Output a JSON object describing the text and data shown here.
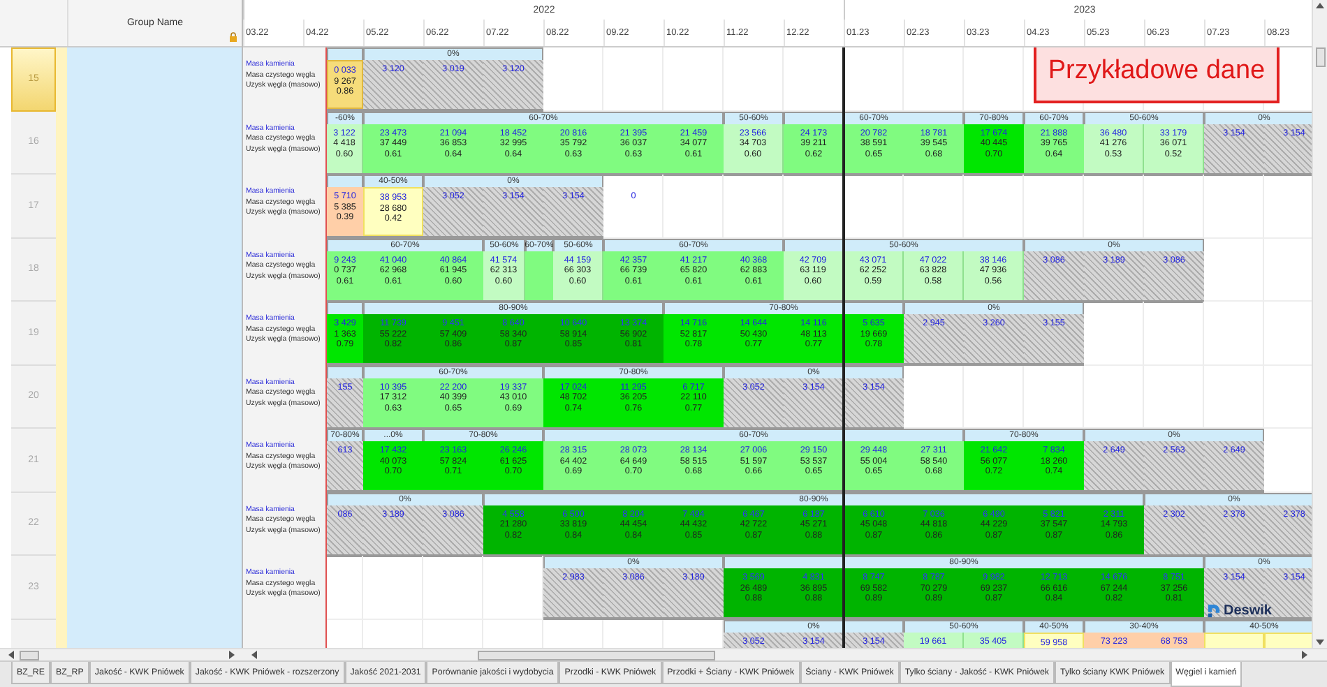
{
  "left_pane": {
    "header": "Group Name"
  },
  "timeline": {
    "years": [
      {
        "label": "2022",
        "months": [
          "03.22",
          "04.22",
          "05.22",
          "06.22",
          "07.22",
          "08.22",
          "09.22",
          "10.22",
          "11.22",
          "12.22"
        ]
      },
      {
        "label": "2023",
        "months": [
          "01.23",
          "02.23",
          "03.23",
          "04.23",
          "05.23",
          "06.23",
          "07.23",
          "08.23"
        ]
      }
    ]
  },
  "watermark_note": "Przykładowe dane",
  "rows": [
    {
      "number": "15",
      "selected": true,
      "labels": [
        "Masa kamienia",
        "Masa czystego węgla",
        "Uzysk węgla (masowo)"
      ],
      "groups": [
        {
          "cells": [
            {
              "kind": "gold",
              "values": [
                "0 033",
                "9 267",
                "0.86"
              ]
            }
          ]
        },
        {
          "label": "0%",
          "cells": [
            {
              "kind": "hatched",
              "values": [
                "3 120"
              ]
            },
            {
              "kind": "hatched",
              "values": [
                "3 019"
              ]
            },
            {
              "kind": "hatched",
              "values": [
                "3 120"
              ]
            }
          ]
        }
      ]
    },
    {
      "number": "16",
      "selected": false,
      "labels": [
        "Masa kamienia",
        "Masa czystego węgla",
        "Uzysk węgla (masowo)"
      ],
      "groups": [
        {
          "label": "-60%",
          "cells": [
            {
              "kind": "pale",
              "values": [
                "3 122",
                "4 418",
                "0.60"
              ]
            }
          ]
        },
        {
          "label": "60-70%",
          "cells": [
            {
              "kind": "green",
              "values": [
                "23 473",
                "37 449",
                "0.61"
              ]
            },
            {
              "kind": "green",
              "values": [
                "21 094",
                "36 853",
                "0.64"
              ]
            },
            {
              "kind": "green",
              "values": [
                "18 452",
                "32 995",
                "0.64"
              ]
            },
            {
              "kind": "green",
              "values": [
                "20 816",
                "35 792",
                "0.63"
              ]
            },
            {
              "kind": "green",
              "values": [
                "21 395",
                "36 037",
                "0.63"
              ]
            },
            {
              "kind": "green",
              "values": [
                "21 459",
                "34 077",
                "0.61"
              ]
            }
          ]
        },
        {
          "label": "50-60%",
          "cells": [
            {
              "kind": "pale",
              "values": [
                "23 566",
                "34 703",
                "0.60"
              ]
            }
          ]
        },
        {
          "label": "60-70%",
          "cells": [
            {
              "kind": "green",
              "values": [
                "24 173",
                "39 211",
                "0.62"
              ]
            },
            {
              "kind": "green",
              "values": [
                "20 782",
                "38 591",
                "0.65"
              ]
            },
            {
              "kind": "green",
              "values": [
                "18 781",
                "39 545",
                "0.68"
              ]
            }
          ]
        },
        {
          "label": "70-80%",
          "cells": [
            {
              "kind": "bright",
              "values": [
                "17 674",
                "40 445",
                "0.70"
              ]
            }
          ]
        },
        {
          "label": "60-70%",
          "cells": [
            {
              "kind": "green",
              "values": [
                "21 888",
                "39 765",
                "0.64"
              ]
            }
          ]
        },
        {
          "label": "50-60%",
          "cells": [
            {
              "kind": "pale",
              "values": [
                "36 480",
                "41 276",
                "0.53"
              ]
            },
            {
              "kind": "pale",
              "values": [
                "33 179",
                "36 071",
                "0.52"
              ]
            }
          ]
        },
        {
          "label": "0%",
          "cells": [
            {
              "kind": "hatched",
              "values": [
                "3 154"
              ]
            },
            {
              "kind": "hatched",
              "values": [
                "3 154"
              ]
            }
          ]
        }
      ]
    },
    {
      "number": "17",
      "selected": false,
      "labels": [
        "Masa kamienia",
        "Masa czystego węgla",
        "Uzysk węgla (masowo)"
      ],
      "groups": [
        {
          "cells": [
            {
              "kind": "orange",
              "values": [
                "5 710",
                "5 385",
                "0.39"
              ]
            }
          ]
        },
        {
          "label": "40-50%",
          "cells": [
            {
              "kind": "yellow",
              "values": [
                "38 953",
                "28 680",
                "0.42"
              ]
            }
          ]
        },
        {
          "label": "0%",
          "cells": [
            {
              "kind": "hatched",
              "values": [
                "3 052"
              ]
            },
            {
              "kind": "hatched",
              "values": [
                "3 154"
              ]
            },
            {
              "kind": "hatched",
              "values": [
                "3 154"
              ]
            }
          ]
        },
        {
          "cells": [
            {
              "kind": "blank",
              "values": [
                "0"
              ]
            }
          ]
        }
      ]
    },
    {
      "number": "18",
      "selected": false,
      "labels": [
        "Masa kamienia",
        "Masa czystego węgla",
        "Uzysk węgla (masowo)"
      ],
      "groups": [
        {
          "label": "60-70%",
          "cells": [
            {
              "kind": "green",
              "values": [
                "9 243",
                "0 737",
                "0.61"
              ]
            },
            {
              "kind": "green",
              "values": [
                "41 040",
                "62 968",
                "0.61"
              ]
            },
            {
              "kind": "green",
              "values": [
                "40 864",
                "61 945",
                "0.60"
              ]
            }
          ]
        },
        {
          "label": "50-60%",
          "cells": [
            {
              "kind": "pale",
              "values": [
                "41 574",
                "62 313",
                "0.60"
              ]
            }
          ]
        },
        {
          "label": "60-70%",
          "cells": [
            {
              "kind": "sliver"
            }
          ]
        },
        {
          "label": "50-60%",
          "cells": [
            {
              "kind": "pale",
              "values": [
                "44 159",
                "66 303",
                "0.60"
              ]
            }
          ]
        },
        {
          "label": "60-70%",
          "cells": [
            {
              "kind": "green",
              "values": [
                "42 357",
                "66 739",
                "0.61"
              ]
            },
            {
              "kind": "green",
              "values": [
                "41 217",
                "65 820",
                "0.61"
              ]
            },
            {
              "kind": "green",
              "values": [
                "40 368",
                "62 883",
                "0.61"
              ]
            }
          ]
        },
        {
          "label": "50-60%",
          "cells": [
            {
              "kind": "pale",
              "values": [
                "42 709",
                "63 119",
                "0.60"
              ]
            },
            {
              "kind": "pale",
              "values": [
                "43 071",
                "62 252",
                "0.59"
              ]
            },
            {
              "kind": "pale",
              "values": [
                "47 022",
                "63 828",
                "0.58"
              ]
            },
            {
              "kind": "pale",
              "values": [
                "38 146",
                "47 936",
                "0.56"
              ]
            }
          ]
        },
        {
          "label": "0%",
          "cells": [
            {
              "kind": "hatched",
              "values": [
                "3 086"
              ]
            },
            {
              "kind": "hatched",
              "values": [
                "3 189"
              ]
            },
            {
              "kind": "hatched",
              "values": [
                "3 086"
              ]
            }
          ]
        }
      ]
    },
    {
      "number": "19",
      "selected": false,
      "labels": [
        "Masa kamienia",
        "Masa czystego węgla",
        "Uzysk węgla (masowo)"
      ],
      "groups": [
        {
          "cells": [
            {
              "kind": "bright",
              "values": [
                "3 429",
                "1 363",
                "0.79"
              ]
            }
          ]
        },
        {
          "label": "80-90%",
          "cells": [
            {
              "kind": "dark",
              "values": [
                "11 739",
                "55 222",
                "0.82"
              ]
            },
            {
              "kind": "dark",
              "values": [
                "9 451",
                "57 409",
                "0.86"
              ]
            },
            {
              "kind": "dark",
              "values": [
                "8 640",
                "58 340",
                "0.87"
              ]
            },
            {
              "kind": "dark",
              "values": [
                "10 640",
                "58 914",
                "0.85"
              ]
            },
            {
              "kind": "dark",
              "values": [
                "13 374",
                "56 902",
                "0.81"
              ]
            }
          ]
        },
        {
          "label": "70-80%",
          "cells": [
            {
              "kind": "bright",
              "values": [
                "14 716",
                "52 817",
                "0.78"
              ]
            },
            {
              "kind": "bright",
              "values": [
                "14 644",
                "50 430",
                "0.77"
              ]
            },
            {
              "kind": "bright",
              "values": [
                "14 116",
                "48 113",
                "0.77"
              ]
            },
            {
              "kind": "bright",
              "values": [
                "5 635",
                "19 669",
                "0.78"
              ]
            }
          ]
        },
        {
          "label": "0%",
          "cells": [
            {
              "kind": "hatched",
              "values": [
                "2 945"
              ]
            },
            {
              "kind": "hatched",
              "values": [
                "3 260"
              ]
            },
            {
              "kind": "hatched",
              "values": [
                "3 155"
              ]
            }
          ]
        }
      ]
    },
    {
      "number": "20",
      "selected": false,
      "labels": [
        "Masa kamienia",
        "Masa czystego węgla",
        "Uzysk węgla (masowo)"
      ],
      "groups": [
        {
          "cells": [
            {
              "kind": "hatched",
              "values": [
                "155"
              ]
            }
          ]
        },
        {
          "label": "60-70%",
          "cells": [
            {
              "kind": "green",
              "values": [
                "10 395",
                "17 312",
                "0.63"
              ]
            },
            {
              "kind": "green",
              "values": [
                "22 200",
                "40 399",
                "0.65"
              ]
            },
            {
              "kind": "green",
              "values": [
                "19 337",
                "43 010",
                "0.69"
              ]
            }
          ]
        },
        {
          "label": "70-80%",
          "cells": [
            {
              "kind": "bright",
              "values": [
                "17 024",
                "48 702",
                "0.74"
              ]
            },
            {
              "kind": "bright",
              "values": [
                "11 295",
                "36 205",
                "0.76"
              ]
            },
            {
              "kind": "bright",
              "values": [
                "6 717",
                "22 110",
                "0.77"
              ]
            }
          ]
        },
        {
          "label": "0%",
          "cells": [
            {
              "kind": "hatched",
              "values": [
                "3 052"
              ]
            },
            {
              "kind": "hatched",
              "values": [
                "3 154"
              ]
            },
            {
              "kind": "hatched",
              "values": [
                "3 154"
              ]
            }
          ]
        }
      ]
    },
    {
      "number": "21",
      "selected": false,
      "labels": [
        "Masa kamienia",
        "Masa czystego węgla",
        "Uzysk węgla (masowo)"
      ],
      "groups": [
        {
          "label": "70-80%",
          "cells": [
            {
              "kind": "hatched",
              "values": [
                "613"
              ]
            }
          ]
        },
        {
          "label": "...0%",
          "cells": [
            {
              "kind": "bright",
              "values": [
                "17 432",
                "40 073",
                "0.70"
              ]
            }
          ]
        },
        {
          "label": "70-80%",
          "cells": [
            {
              "kind": "bright",
              "values": [
                "23 163",
                "57 824",
                "0.71"
              ]
            },
            {
              "kind": "bright",
              "values": [
                "26 246",
                "61 625",
                "0.70"
              ]
            }
          ]
        },
        {
          "label": "60-70%",
          "cells": [
            {
              "kind": "green",
              "values": [
                "28 315",
                "64 402",
                "0.69"
              ]
            },
            {
              "kind": "green",
              "values": [
                "28 073",
                "64 649",
                "0.70"
              ]
            },
            {
              "kind": "green",
              "values": [
                "28 134",
                "58 515",
                "0.68"
              ]
            },
            {
              "kind": "green",
              "values": [
                "27 006",
                "51 597",
                "0.66"
              ]
            },
            {
              "kind": "green",
              "values": [
                "29 150",
                "53 537",
                "0.65"
              ]
            },
            {
              "kind": "green",
              "values": [
                "29 448",
                "55 004",
                "0.65"
              ]
            },
            {
              "kind": "green",
              "values": [
                "27 311",
                "58 540",
                "0.68"
              ]
            }
          ]
        },
        {
          "label": "70-80%",
          "cells": [
            {
              "kind": "bright",
              "values": [
                "21 642",
                "56 077",
                "0.72"
              ]
            },
            {
              "kind": "bright",
              "values": [
                "7 834",
                "18 260",
                "0.74"
              ]
            }
          ]
        },
        {
          "label": "0%",
          "cells": [
            {
              "kind": "hatched",
              "values": [
                "2 649"
              ]
            },
            {
              "kind": "hatched",
              "values": [
                "2 563"
              ]
            },
            {
              "kind": "hatched",
              "values": [
                "2 649"
              ]
            }
          ]
        }
      ]
    },
    {
      "number": "22",
      "selected": false,
      "labels": [
        "Masa kamienia",
        "Masa czystego węgla",
        "Uzysk węgla (masowo)"
      ],
      "groups": [
        {
          "label": "0%",
          "cells": [
            {
              "kind": "hatched",
              "values": [
                "086"
              ]
            },
            {
              "kind": "hatched",
              "values": [
                "3 189"
              ]
            },
            {
              "kind": "hatched",
              "values": [
                "3 086"
              ]
            }
          ]
        },
        {
          "label": "80-90%",
          "cells": [
            {
              "kind": "dark",
              "values": [
                "4 558",
                "21 280",
                "0.82"
              ]
            },
            {
              "kind": "dark",
              "values": [
                "6 500",
                "33 819",
                "0.84"
              ]
            },
            {
              "kind": "dark",
              "values": [
                "8 204",
                "44 454",
                "0.84"
              ]
            },
            {
              "kind": "dark",
              "values": [
                "7 494",
                "44 432",
                "0.85"
              ]
            },
            {
              "kind": "dark",
              "values": [
                "6 467",
                "42 722",
                "0.87"
              ]
            },
            {
              "kind": "dark",
              "values": [
                "6 187",
                "45 271",
                "0.88"
              ]
            },
            {
              "kind": "dark",
              "values": [
                "6 610",
                "45 048",
                "0.87"
              ]
            },
            {
              "kind": "dark",
              "values": [
                "7 036",
                "44 818",
                "0.86"
              ]
            },
            {
              "kind": "dark",
              "values": [
                "6 490",
                "44 229",
                "0.87"
              ]
            },
            {
              "kind": "dark",
              "values": [
                "5 821",
                "37 547",
                "0.87"
              ]
            },
            {
              "kind": "dark",
              "values": [
                "2 311",
                "14 793",
                "0.86"
              ]
            }
          ]
        },
        {
          "label": "0%",
          "cells": [
            {
              "kind": "hatched",
              "values": [
                "2 302"
              ]
            },
            {
              "kind": "hatched",
              "values": [
                "2 378"
              ]
            },
            {
              "kind": "hatched",
              "values": [
                "2 378"
              ]
            }
          ]
        }
      ]
    },
    {
      "number": "23",
      "selected": false,
      "labels": [
        "Masa kamienia",
        "Masa czystego węgla",
        "Uzysk węgla (masowo)"
      ],
      "groups": [
        {
          "cells": [
            {
              "kind": "blank"
            },
            {
              "kind": "blank"
            },
            {
              "kind": "blank"
            },
            {
              "kind": "blank"
            }
          ]
        },
        {
          "label": "0%",
          "cells": [
            {
              "kind": "hatched",
              "values": [
                "2 983"
              ]
            },
            {
              "kind": "hatched",
              "values": [
                "3 086"
              ]
            },
            {
              "kind": "hatched",
              "values": [
                "3 189"
              ]
            }
          ]
        },
        {
          "label": "80-90%",
          "cells": [
            {
              "kind": "dark",
              "values": [
                "3 569",
                "26 489",
                "0.88"
              ]
            },
            {
              "kind": "dark",
              "values": [
                "4 831",
                "36 895",
                "0.88"
              ]
            },
            {
              "kind": "dark",
              "values": [
                "8 747",
                "69 582",
                "0.89"
              ]
            },
            {
              "kind": "dark",
              "values": [
                "8 787",
                "70 279",
                "0.89"
              ]
            },
            {
              "kind": "dark",
              "values": [
                "9 982",
                "69 237",
                "0.87"
              ]
            },
            {
              "kind": "dark",
              "values": [
                "12 713",
                "66 616",
                "0.84"
              ]
            },
            {
              "kind": "dark",
              "values": [
                "14 676",
                "67 244",
                "0.82"
              ]
            },
            {
              "kind": "dark",
              "values": [
                "8 751",
                "37 256",
                "0.81"
              ]
            }
          ]
        },
        {
          "label": "0%",
          "cells": [
            {
              "kind": "hatched",
              "values": [
                "3 154"
              ]
            },
            {
              "kind": "hatched",
              "values": [
                "3 154"
              ]
            }
          ]
        }
      ]
    },
    {
      "selected": false,
      "groups": [
        {
          "cells": [
            {
              "kind": "blank"
            },
            {
              "kind": "blank"
            },
            {
              "kind": "blank"
            },
            {
              "kind": "blank"
            },
            {
              "kind": "blank"
            },
            {
              "kind": "blank"
            },
            {
              "kind": "blank"
            }
          ]
        },
        {
          "label": "0%",
          "cells": [
            {
              "kind": "hatched",
              "values": [
                "3 052"
              ]
            },
            {
              "kind": "hatched",
              "values": [
                "3 154"
              ]
            },
            {
              "kind": "hatched",
              "values": [
                "3 154"
              ]
            }
          ]
        },
        {
          "label": "50-60%",
          "cells": [
            {
              "kind": "pale",
              "values": [
                "19 661"
              ]
            },
            {
              "kind": "pale",
              "values": [
                "35 405"
              ]
            }
          ]
        },
        {
          "label": "40-50%",
          "cells": [
            {
              "kind": "yellow",
              "values": [
                "59 958"
              ]
            }
          ]
        },
        {
          "label": "30-40%",
          "cells": [
            {
              "kind": "orange",
              "values": [
                "73 223"
              ]
            },
            {
              "kind": "orange",
              "values": [
                "68 753"
              ]
            }
          ]
        },
        {
          "label": "40-50%",
          "cells": [
            {
              "kind": "yellow"
            },
            {
              "kind": "yellow"
            }
          ]
        }
      ]
    }
  ],
  "logo": {
    "text": "Deswik"
  },
  "sheet_tabs": [
    {
      "label": "BZ_RE",
      "selected": false
    },
    {
      "label": "BZ_RP",
      "selected": false
    },
    {
      "label": "Jakość - KWK Pniówek",
      "selected": false
    },
    {
      "label": "Jakość - KWK Pniówek - rozszerzony",
      "selected": false
    },
    {
      "label": "Jakość 2021-2031",
      "selected": false
    },
    {
      "label": "Porównanie jakości i wydobycia",
      "selected": false
    },
    {
      "label": "Przodki - KWK Pniówek",
      "selected": false
    },
    {
      "label": "Przodki + Ściany - KWK Pniówek",
      "selected": false
    },
    {
      "label": "Ściany - KWK Pniówek",
      "selected": false
    },
    {
      "label": "Tylko ściany - Jakość - KWK Pniówek",
      "selected": false
    },
    {
      "label": "Tylko ściany KWK Pniówek",
      "selected": false
    },
    {
      "label": "Węgiel i kamień",
      "selected": true
    }
  ]
}
